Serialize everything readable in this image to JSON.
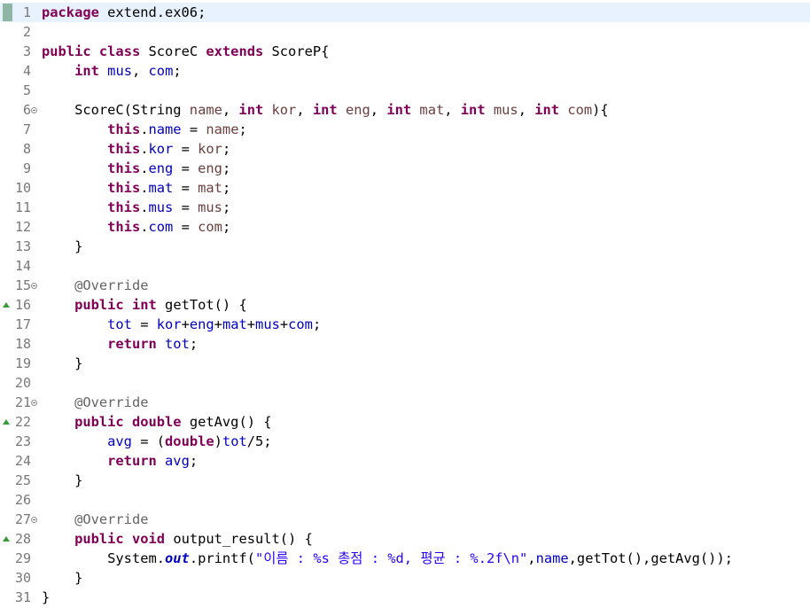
{
  "editor": {
    "current_line": 1,
    "fold_lines": [
      6,
      15,
      21,
      27
    ],
    "override_lines": [
      16,
      22,
      28
    ],
    "lines": [
      {
        "n": "1",
        "tokens": [
          {
            "t": "package",
            "c": "kw"
          },
          {
            "t": " extend.ex06;"
          }
        ]
      },
      {
        "n": "2",
        "tokens": []
      },
      {
        "n": "3",
        "tokens": [
          {
            "t": "public",
            "c": "kw"
          },
          {
            "t": " "
          },
          {
            "t": "class",
            "c": "kw"
          },
          {
            "t": " ScoreC "
          },
          {
            "t": "extends",
            "c": "kw"
          },
          {
            "t": " ScoreP{"
          }
        ]
      },
      {
        "n": "4",
        "tokens": [
          {
            "t": "    "
          },
          {
            "t": "int",
            "c": "kw"
          },
          {
            "t": " "
          },
          {
            "t": "mus",
            "c": "fld"
          },
          {
            "t": ", "
          },
          {
            "t": "com",
            "c": "fld"
          },
          {
            "t": ";"
          }
        ]
      },
      {
        "n": "5",
        "tokens": []
      },
      {
        "n": "6",
        "tokens": [
          {
            "t": "    ScoreC(String "
          },
          {
            "t": "name",
            "c": "prm"
          },
          {
            "t": ", "
          },
          {
            "t": "int",
            "c": "kw"
          },
          {
            "t": " "
          },
          {
            "t": "kor",
            "c": "prm"
          },
          {
            "t": ", "
          },
          {
            "t": "int",
            "c": "kw"
          },
          {
            "t": " "
          },
          {
            "t": "eng",
            "c": "prm"
          },
          {
            "t": ", "
          },
          {
            "t": "int",
            "c": "kw"
          },
          {
            "t": " "
          },
          {
            "t": "mat",
            "c": "prm"
          },
          {
            "t": ", "
          },
          {
            "t": "int",
            "c": "kw"
          },
          {
            "t": " "
          },
          {
            "t": "mus",
            "c": "prm"
          },
          {
            "t": ", "
          },
          {
            "t": "int",
            "c": "kw"
          },
          {
            "t": " "
          },
          {
            "t": "com",
            "c": "prm"
          },
          {
            "t": "){"
          }
        ]
      },
      {
        "n": "7",
        "tokens": [
          {
            "t": "        "
          },
          {
            "t": "this",
            "c": "kw"
          },
          {
            "t": "."
          },
          {
            "t": "name",
            "c": "fld"
          },
          {
            "t": " = "
          },
          {
            "t": "name",
            "c": "prm"
          },
          {
            "t": ";"
          }
        ]
      },
      {
        "n": "8",
        "tokens": [
          {
            "t": "        "
          },
          {
            "t": "this",
            "c": "kw"
          },
          {
            "t": "."
          },
          {
            "t": "kor",
            "c": "fld"
          },
          {
            "t": " = "
          },
          {
            "t": "kor",
            "c": "prm"
          },
          {
            "t": ";"
          }
        ]
      },
      {
        "n": "9",
        "tokens": [
          {
            "t": "        "
          },
          {
            "t": "this",
            "c": "kw"
          },
          {
            "t": "."
          },
          {
            "t": "eng",
            "c": "fld"
          },
          {
            "t": " = "
          },
          {
            "t": "eng",
            "c": "prm"
          },
          {
            "t": ";"
          }
        ]
      },
      {
        "n": "10",
        "tokens": [
          {
            "t": "        "
          },
          {
            "t": "this",
            "c": "kw"
          },
          {
            "t": "."
          },
          {
            "t": "mat",
            "c": "fld"
          },
          {
            "t": " = "
          },
          {
            "t": "mat",
            "c": "prm"
          },
          {
            "t": ";"
          }
        ]
      },
      {
        "n": "11",
        "tokens": [
          {
            "t": "        "
          },
          {
            "t": "this",
            "c": "kw"
          },
          {
            "t": "."
          },
          {
            "t": "mus",
            "c": "fld"
          },
          {
            "t": " = "
          },
          {
            "t": "mus",
            "c": "prm"
          },
          {
            "t": ";"
          }
        ]
      },
      {
        "n": "12",
        "tokens": [
          {
            "t": "        "
          },
          {
            "t": "this",
            "c": "kw"
          },
          {
            "t": "."
          },
          {
            "t": "com",
            "c": "fld"
          },
          {
            "t": " = "
          },
          {
            "t": "com",
            "c": "prm"
          },
          {
            "t": ";"
          }
        ]
      },
      {
        "n": "13",
        "tokens": [
          {
            "t": "    }"
          }
        ]
      },
      {
        "n": "14",
        "tokens": []
      },
      {
        "n": "15",
        "tokens": [
          {
            "t": "    "
          },
          {
            "t": "@Override",
            "c": "ann"
          }
        ]
      },
      {
        "n": "16",
        "tokens": [
          {
            "t": "    "
          },
          {
            "t": "public",
            "c": "kw"
          },
          {
            "t": " "
          },
          {
            "t": "int",
            "c": "kw"
          },
          {
            "t": " getTot() {"
          }
        ]
      },
      {
        "n": "17",
        "tokens": [
          {
            "t": "        "
          },
          {
            "t": "tot",
            "c": "fld"
          },
          {
            "t": " = "
          },
          {
            "t": "kor",
            "c": "fld"
          },
          {
            "t": "+"
          },
          {
            "t": "eng",
            "c": "fld"
          },
          {
            "t": "+"
          },
          {
            "t": "mat",
            "c": "fld"
          },
          {
            "t": "+"
          },
          {
            "t": "mus",
            "c": "fld"
          },
          {
            "t": "+"
          },
          {
            "t": "com",
            "c": "fld"
          },
          {
            "t": ";"
          }
        ]
      },
      {
        "n": "18",
        "tokens": [
          {
            "t": "        "
          },
          {
            "t": "return",
            "c": "kw"
          },
          {
            "t": " "
          },
          {
            "t": "tot",
            "c": "fld"
          },
          {
            "t": ";"
          }
        ]
      },
      {
        "n": "19",
        "tokens": [
          {
            "t": "    }"
          }
        ]
      },
      {
        "n": "20",
        "tokens": []
      },
      {
        "n": "21",
        "tokens": [
          {
            "t": "    "
          },
          {
            "t": "@Override",
            "c": "ann"
          }
        ]
      },
      {
        "n": "22",
        "tokens": [
          {
            "t": "    "
          },
          {
            "t": "public",
            "c": "kw"
          },
          {
            "t": " "
          },
          {
            "t": "double",
            "c": "kw"
          },
          {
            "t": " getAvg() {"
          }
        ]
      },
      {
        "n": "23",
        "tokens": [
          {
            "t": "        "
          },
          {
            "t": "avg",
            "c": "fld"
          },
          {
            "t": " = ("
          },
          {
            "t": "double",
            "c": "kw"
          },
          {
            "t": ")"
          },
          {
            "t": "tot",
            "c": "fld"
          },
          {
            "t": "/5;"
          }
        ]
      },
      {
        "n": "24",
        "tokens": [
          {
            "t": "        "
          },
          {
            "t": "return",
            "c": "kw"
          },
          {
            "t": " "
          },
          {
            "t": "avg",
            "c": "fld"
          },
          {
            "t": ";"
          }
        ]
      },
      {
        "n": "25",
        "tokens": [
          {
            "t": "    }"
          }
        ]
      },
      {
        "n": "26",
        "tokens": []
      },
      {
        "n": "27",
        "tokens": [
          {
            "t": "    "
          },
          {
            "t": "@Override",
            "c": "ann"
          }
        ]
      },
      {
        "n": "28",
        "tokens": [
          {
            "t": "    "
          },
          {
            "t": "public",
            "c": "kw"
          },
          {
            "t": " "
          },
          {
            "t": "void",
            "c": "kw"
          },
          {
            "t": " output_result() {"
          }
        ]
      },
      {
        "n": "29",
        "tokens": [
          {
            "t": "        System."
          },
          {
            "t": "out",
            "c": "sfld"
          },
          {
            "t": ".printf("
          },
          {
            "t": "\"이름 : %s 총점 : %d, 평균 : %.2f\\n\"",
            "c": "str"
          },
          {
            "t": ","
          },
          {
            "t": "name",
            "c": "fld"
          },
          {
            "t": ",getTot(),getAvg());"
          }
        ]
      },
      {
        "n": "30",
        "tokens": [
          {
            "t": "    }"
          }
        ]
      },
      {
        "n": "31",
        "tokens": [
          {
            "t": "}"
          }
        ]
      }
    ]
  }
}
